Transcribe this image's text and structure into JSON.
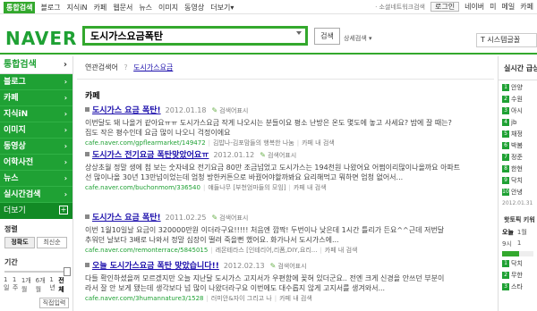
{
  "topnav": {
    "items": [
      "통합검색",
      "블로그",
      "지식iN",
      "카페",
      "웹문서",
      "뉴스",
      "이미지",
      "동영상",
      "더보기"
    ],
    "more_arrow": "▾",
    "assistant": "ㆍ소셜네트워크검색",
    "login": "로그인",
    "right_links": [
      "네이버",
      "미",
      "메일",
      "카페"
    ]
  },
  "header": {
    "logo": "NAVER",
    "query": "도시가스요금폭탄",
    "search_button": "검색",
    "detail_search": "상세검색 ▾",
    "side_box": "T 시스템글꼴"
  },
  "sidebar": {
    "title": "통합검색",
    "items": [
      "블로그",
      "카페",
      "지식iN",
      "이미지",
      "동영상",
      "어학사전",
      "뉴스",
      "실시간검색"
    ],
    "more": "더보기",
    "sort_label": "정렬",
    "sort_options": [
      "정확도",
      "최신순"
    ],
    "sort_selected": "정확도",
    "period_label": "기간",
    "period_ticks": [
      "1일",
      "1주",
      "1개월",
      "6개월",
      "1년",
      "전체"
    ],
    "period_selected": "전체",
    "apply": "직접입력"
  },
  "main": {
    "related_label": "연관검색어",
    "related_sep": "?",
    "related_link": "도시가스요금",
    "section_title": "카페",
    "results": [
      {
        "title": "도시가스 요금 폭탄!",
        "date": "2012.01.18",
        "search_in": "검색어표시",
        "desc1": "이번달도 돼 나올거 같아요ㅠㅠ 도시가스요금 작게 나오시는 분들이요 평소 난방은 온도 몇도에 놓고 사세요? 밤에 잘 때는?",
        "desc2": "집도 작은 평수인데 요금 많이 나오니 걱정이에요",
        "url": "cafe.naver.com/gpflearmarket/149472",
        "cafe": "김밥나-김포맘들의 행복한 나눔",
        "cafe_search": "카페 내 검색"
      },
      {
        "title": "도시가스 전기요금 폭탄맞았어요ㅠ",
        "date": "2012.01.12",
        "search_in": "검색어표시",
        "desc1": "상상초월 정말 생에 첨 보는 숫자네요 전기요금 80만 조금넘었고 도시가스는 194천원 나왔어요 어쩜이리많이나올까요 아파트",
        "desc2": "선 많이나올 30년 13만넘이었는데 엄청 방한커튼으로 바꿨어야할까봐요 요리해먹고 뭐하면 엄청 없어서...",
        "url": "cafe.naver.com/buchonmom/336540",
        "cafe": "얘들나무 [부천엄마들의 모임]",
        "cafe_search": "카페 내 검색"
      },
      {
        "title": "도시가스 요금 폭탄!",
        "date": "2011.02.25",
        "search_in": "검색어표시",
        "desc1": "이번 1월10일날 요금이 320000만원 이더라구요!!!!! 처음엔 깜짝! 두번이나 낮은데 1시간 틀리가 든요^^근데 저번달",
        "desc2": "추워던 날보다 3배로 나와서 정말 심장이 떨려 죽을뻔 했어요. 화가나서 도시가스에...",
        "url": "cafe.naver.com/remonterrace/5845015",
        "cafe": "레몬테라스 [인테리어,리폼,DIY,요리...",
        "cafe_search": "카페 내 검색"
      },
      {
        "title": "오늘 도시가스요금 폭탄 맞았습니다!!",
        "date": "2012.02.13",
        "search_in": "검색어표시",
        "desc1": "다들 확인하셨을꺼 모르겠지만 오늘 지난달 도시가스 고지서가 우편함에 꽂혀 있더군요.. 전엔 크게 신경을 안쓰던 부분이",
        "desc2": "라서 잘 안 보게 됐는데 생각보다 넘 많이 나왔더라구요 이번에도 대수롭지 않게 고지서를 생겨와서...",
        "url": "cafe.naver.com/3humannature3/1528",
        "cafe": "러미안&자이 그리고 나",
        "cafe_search": "카페 내 검색"
      }
    ]
  },
  "rightcol": {
    "title": "실시간 급상",
    "items": [
      "안양",
      "수원",
      "아시",
      "jb",
      "채정",
      "박봄",
      "정준",
      "한현",
      "닥치",
      "안녕"
    ],
    "date": "2012.01.31",
    "title2": "핫토픽 키워",
    "tabs": [
      "오늘",
      "1월"
    ],
    "hours": [
      "9시",
      "1"
    ],
    "hot_items": [
      "닥치",
      "무한",
      "스타"
    ]
  }
}
